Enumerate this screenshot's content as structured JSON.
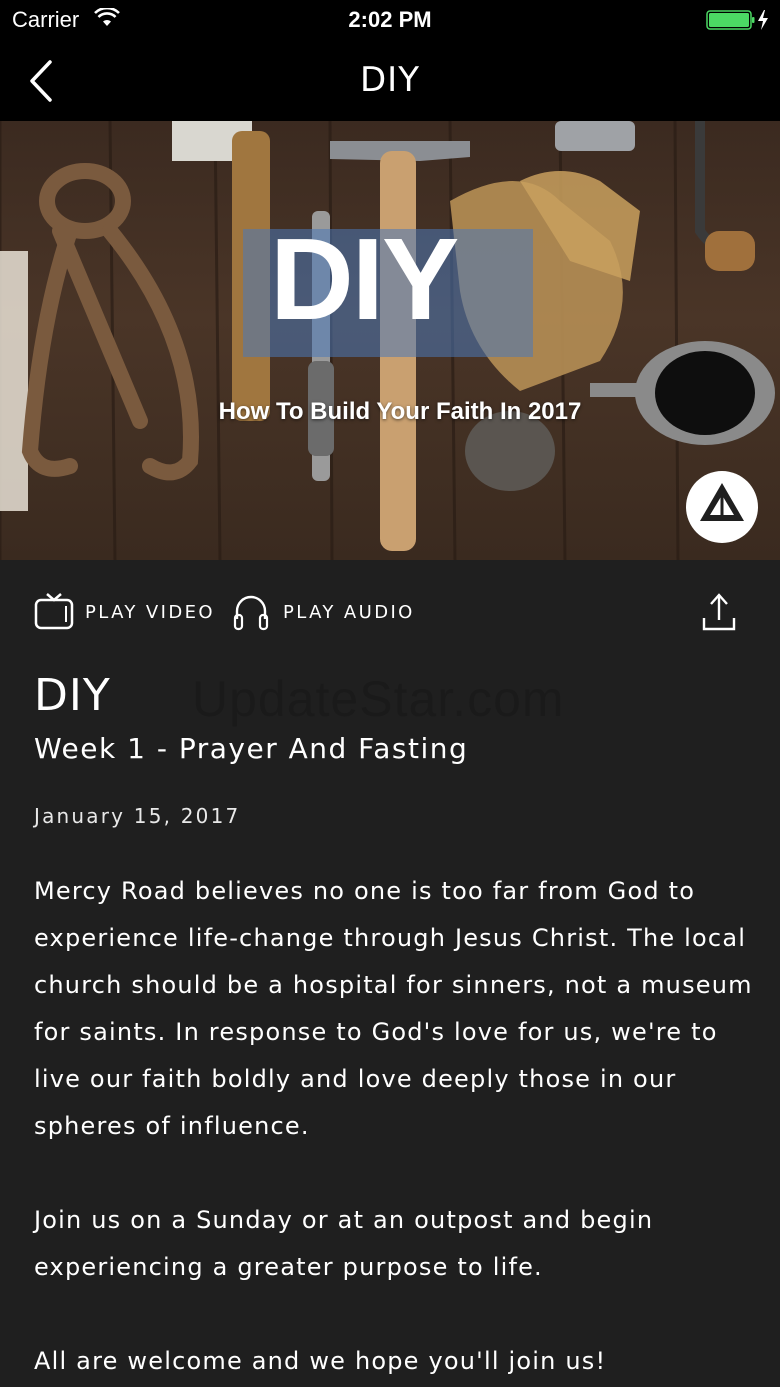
{
  "status_bar": {
    "carrier": "Carrier",
    "time": "2:02 PM",
    "battery_color": "#4cd964"
  },
  "nav": {
    "title": "DIY",
    "back_icon": "chevron-left-icon"
  },
  "hero": {
    "title": "DIY",
    "subtitle": "How To Build Your Faith In 2017",
    "accent": "#4a78b8"
  },
  "actions": {
    "play_video_label": "PLAY VIDEO",
    "play_audio_label": "PLAY AUDIO",
    "video_icon": "tv-icon",
    "audio_icon": "headphones-icon",
    "share_icon": "share-icon"
  },
  "watermark": "UpdateStar.com",
  "sermon": {
    "series": "DIY",
    "title": "Week 1 - Prayer And Fasting",
    "date": "January 15, 2017",
    "description": [
      "Mercy Road believes no one is too far from God to experience life-change through Jesus Christ. The local church should be a hospital for sinners, not a museum for saints. In response to God's love for us, we're to live our faith boldly and love deeply those in our spheres of influence.",
      "Join us on a Sunday or at an outpost and begin experiencing a greater purpose to life.",
      "All are welcome and we hope you'll join us!"
    ]
  }
}
